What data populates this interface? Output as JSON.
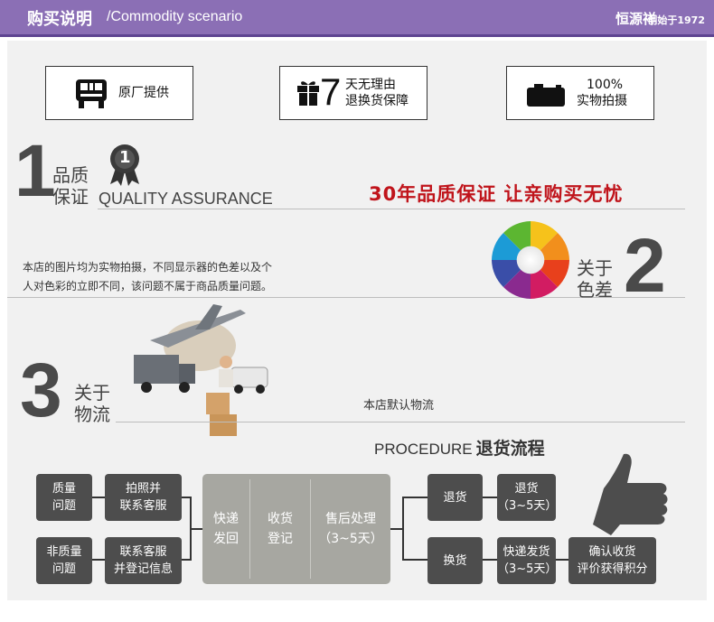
{
  "header": {
    "title_zh": "购买说明",
    "title_en": "/Commodity  scenario",
    "brand": "恒源祥",
    "brand_sub": "创始于1972"
  },
  "features": [
    {
      "label": "原厂提供",
      "icon": "truck-icon"
    },
    {
      "label_big": "7",
      "label_line1": "天无理由",
      "label_line2": "退换货保障",
      "icon": "gift-icon"
    },
    {
      "label_line1": "100%",
      "label_line2": "实物拍摄",
      "icon": "camera-icon"
    }
  ],
  "section1": {
    "num": "1",
    "title_line1": "品质",
    "title_line2": "保证",
    "en": "QUALITY ASSURANCE",
    "medal": "1",
    "slogan": "30年品质保证  让亲购买无忧"
  },
  "section2": {
    "num": "2",
    "title_line1": "关于",
    "title_line2": "色差",
    "para_line1": "本店的图片均为实物拍摄，不同显示器的色差以及个",
    "para_line2": "人对色彩的立即不同，该问题不属于商品质量问题。"
  },
  "section3": {
    "num": "3",
    "title_line1": "关于",
    "title_line2": "物流",
    "note": "本店默认物流"
  },
  "procedure": {
    "en": "PROCEDURE",
    "zh": "退货流程",
    "left": [
      {
        "l1": "质量",
        "l2": "问题"
      },
      {
        "l1": "拍照并",
        "l2": "联系客服"
      },
      {
        "l1": "非质量",
        "l2": "问题"
      },
      {
        "l1": "联系客服",
        "l2": "并登记信息"
      }
    ],
    "middle": [
      {
        "l1": "快递",
        "l2": "发回"
      },
      {
        "l1": "收货",
        "l2": "登记"
      },
      {
        "l1": "售后处理",
        "l2": "（3~5天）"
      }
    ],
    "right": {
      "return_label": "退货",
      "return_time_l1": "退货",
      "return_time_l2": "（3~5天）",
      "exchange_label": "换货",
      "ship_l1": "快递发货",
      "ship_l2": "（3~5天）",
      "confirm_l1": "确认收货",
      "confirm_l2": "评价获得积分"
    }
  },
  "colors": {
    "header": "#8b6fb5",
    "accent_red": "#c0141b",
    "dark_box": "#4d4d4d",
    "gray_box": "#a7a7a1"
  }
}
